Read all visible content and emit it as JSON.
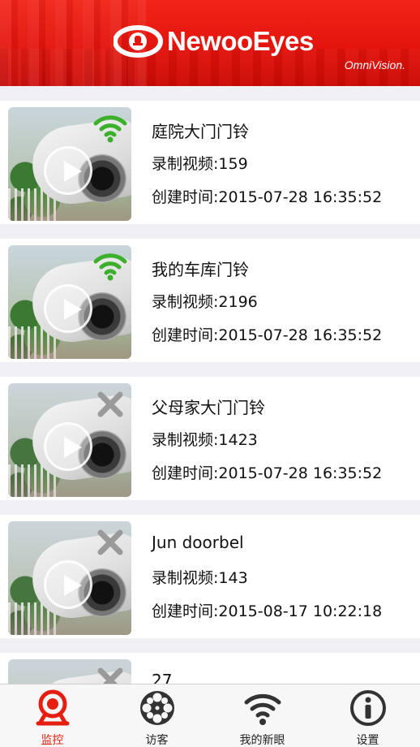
{
  "header": {
    "logo_text": "NewooEyes",
    "brand_sub": "OmniVision.",
    "colors": {
      "primary": "#e61e12",
      "online": "#3cb02c",
      "offline": "#9a9a9a"
    }
  },
  "devices": [
    {
      "name": "庭院大门门铃",
      "recordings": "录制视频:159",
      "created": "创建时间:2015-07-28 16:35:52",
      "status": "online",
      "status_icon": "wifi-icon"
    },
    {
      "name": "我的车库门铃",
      "recordings": "录制视频:2196",
      "created": "创建时间:2015-07-28 16:35:52",
      "status": "online",
      "status_icon": "wifi-icon"
    },
    {
      "name": "父母家大门门铃",
      "recordings": "录制视频:1423",
      "created": "创建时间:2015-07-28 16:35:52",
      "status": "offline",
      "status_icon": "close-icon"
    },
    {
      "name": "Jun doorbel",
      "recordings": "录制视频:143",
      "created": "创建时间:2015-08-17 10:22:18",
      "status": "offline",
      "status_icon": "close-icon"
    },
    {
      "name": "27",
      "recordings": "",
      "created": "",
      "status": "offline",
      "status_icon": "close-icon"
    }
  ],
  "tabs": [
    {
      "label": "监控",
      "icon": "monitor-icon",
      "active": true
    },
    {
      "label": "访客",
      "icon": "film-reel-icon",
      "active": false
    },
    {
      "label": "我的新眼",
      "icon": "wifi-icon",
      "active": false
    },
    {
      "label": "设置",
      "icon": "info-icon",
      "active": false
    }
  ]
}
